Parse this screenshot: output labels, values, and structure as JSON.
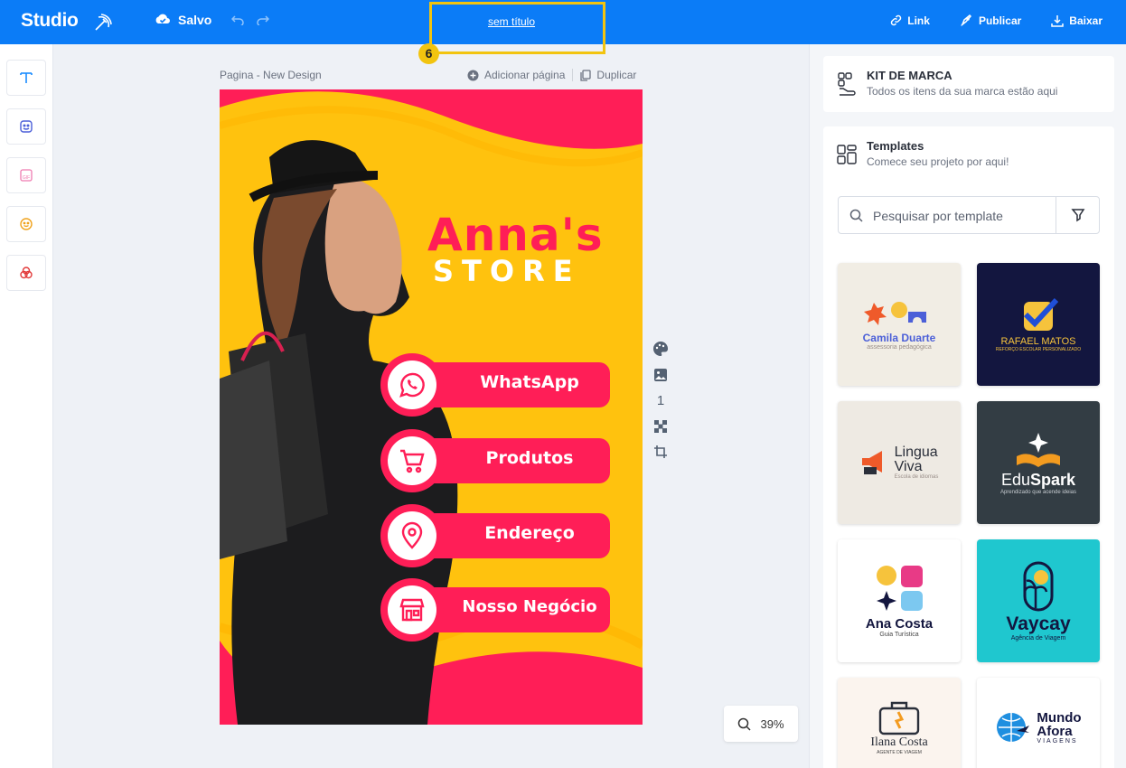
{
  "header": {
    "brand": "Studio",
    "saved_label": "Salvo",
    "doc_title": "sem título",
    "step_number": "6",
    "actions": {
      "link": "Link",
      "publish": "Publicar",
      "download": "Baixar"
    }
  },
  "canvas": {
    "page_label": "Pagina - New Design",
    "add_page": "Adicionar página",
    "duplicate": "Duplicar",
    "page_number": "1",
    "zoom": "39%"
  },
  "design": {
    "title": "Anna's",
    "subtitle": "STORE",
    "buttons": [
      "WhatsApp",
      "Produtos",
      "Endereço",
      "Nosso Negócio"
    ]
  },
  "panel": {
    "kit_title": "KIT DE MARCA",
    "kit_sub": "Todos os itens da sua marca estão aqui",
    "templates_title": "Templates",
    "templates_sub": "Comece seu projeto por aqui!",
    "search_placeholder": "Pesquisar por template",
    "templates": [
      {
        "name": "Camila Duarte",
        "tagline": "assessoria pedagógica"
      },
      {
        "name": "RAFAEL MATOS",
        "tagline": "REFORÇO ESCOLAR PERSONALIZADO"
      },
      {
        "name": "Lingua",
        "name2": "Viva",
        "tagline": "Escola de idiomas"
      },
      {
        "name": "Edu",
        "name2": "Spark",
        "tagline": "Aprendizado que acende ideias"
      },
      {
        "name": "Ana Costa",
        "tagline": "Guia Turística"
      },
      {
        "name": "Vaycay",
        "tagline": "Agência de Viagem"
      },
      {
        "name": "Ilana Costa",
        "tagline": "AGENTE DE VIAGEM"
      },
      {
        "name": "Mundo",
        "name2": "Afora",
        "tagline": "VIAGENS"
      }
    ]
  },
  "colors": {
    "primary": "#0b7cf7",
    "highlight": "#f2c40f",
    "design_pink": "#ff1e57",
    "design_yellow": "#ffc20e"
  }
}
